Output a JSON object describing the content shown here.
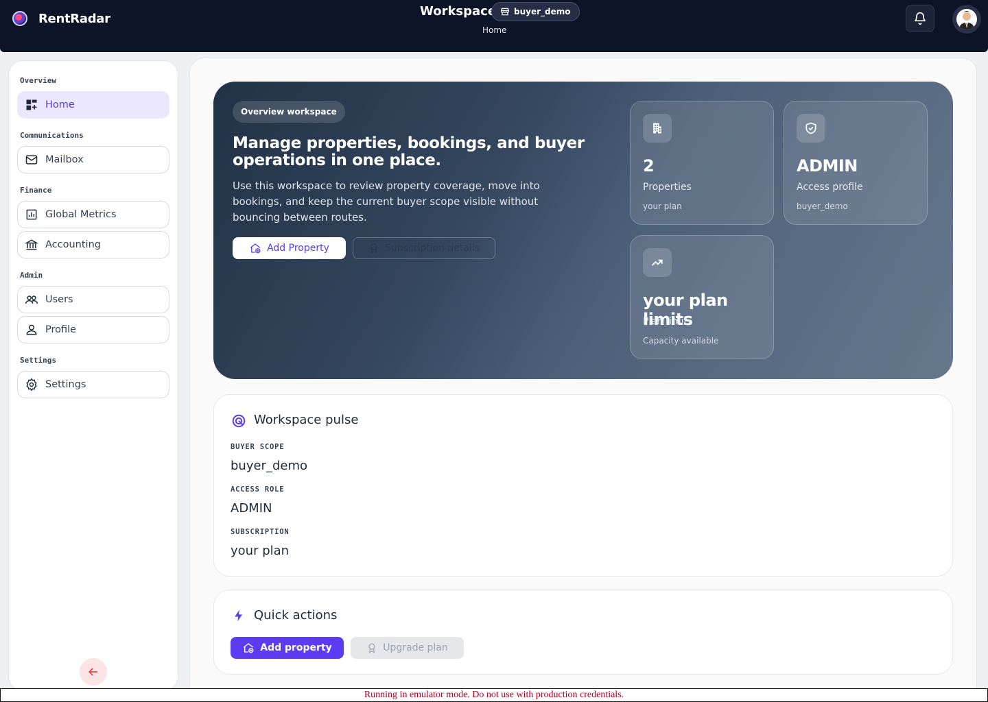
{
  "app": {
    "name": "RentRadar"
  },
  "header": {
    "title": "Workspace",
    "workspace_chip": "buyer_demo",
    "subtitle": "Home"
  },
  "sidebar": {
    "sections": [
      {
        "title": "Overview"
      },
      {
        "title": "Communications"
      },
      {
        "title": "Finance"
      },
      {
        "title": "Admin"
      },
      {
        "title": "Settings"
      }
    ],
    "items": [
      {
        "label": "Home",
        "icon": "dashboard-icon",
        "active": true
      },
      {
        "label": "Mailbox",
        "icon": "mail-icon"
      },
      {
        "label": "Global Metrics",
        "icon": "chart-icon"
      },
      {
        "label": "Accounting",
        "icon": "bank-icon"
      },
      {
        "label": "Users",
        "icon": "users-icon"
      },
      {
        "label": "Profile",
        "icon": "person-icon"
      },
      {
        "label": "Settings",
        "icon": "gear-icon"
      }
    ]
  },
  "hero": {
    "chip": "Overview workspace",
    "title": "Manage properties, bookings, and buyer operations in one place.",
    "description": "Use this workspace to review property coverage, move into bookings, and keep the current buyer scope visible without bouncing between routes.",
    "primary_button": "Add Property",
    "secondary_button": "Subscription details",
    "stats": [
      {
        "value": "2",
        "label": "Properties",
        "note": "your plan",
        "icon": "building-icon"
      },
      {
        "value": "ADMIN",
        "label": "Access profile",
        "note": "buyer_demo",
        "icon": "shield-icon"
      },
      {
        "value": "your plan limits",
        "label": "Plan limit",
        "note": "Capacity available",
        "icon": "trending-up-icon"
      }
    ]
  },
  "pulse": {
    "title": "Workspace pulse",
    "rows": [
      {
        "label": "BUYER SCOPE",
        "value": "buyer_demo"
      },
      {
        "label": "ACCESS ROLE",
        "value": "ADMIN"
      },
      {
        "label": "SUBSCRIPTION",
        "value": "your plan"
      }
    ]
  },
  "quick_actions": {
    "title": "Quick actions",
    "primary_button": "Add property",
    "disabled_button": "Upgrade plan"
  },
  "emulator_notice": "Running in emulator mode. Do not use with production credentials.",
  "colors": {
    "accent": "#5b3cf0",
    "header_bg": "#0d1428",
    "active_item_bg": "#ebe7ff"
  }
}
